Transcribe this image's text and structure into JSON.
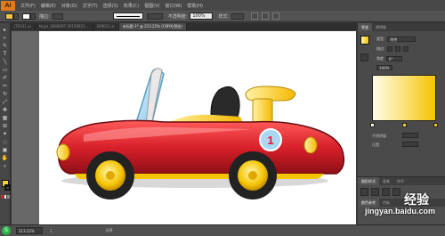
{
  "app": {
    "logo": "Ai"
  },
  "menubar": {
    "items": [
      "文件(F)",
      "编辑(E)",
      "对象(O)",
      "文字(T)",
      "选择(S)",
      "效果(C)",
      "视图(V)",
      "窗口(W)",
      "帮助(H)"
    ]
  },
  "controlbar": {
    "stroke_label": "描边:",
    "stroke_weight": "",
    "opacity_label": "不透明度:",
    "opacity_value": "100%",
    "style_label": "样式:"
  },
  "doctabs": [
    {
      "label": "JT0131.ai",
      "active": false
    },
    {
      "label": "hkjpz_2666007 20150821...",
      "active": false
    },
    {
      "label": "269011.ai",
      "active": false
    },
    {
      "label": "未标题-1* @ 213.22% (CMYK/预览)",
      "active": true
    }
  ],
  "toolbox": {
    "tools": [
      "▸",
      "▹",
      "✎",
      "T",
      "╲",
      "▭",
      "✐",
      "✂",
      "↻",
      "⤢",
      "✤",
      "▦",
      "⊞",
      "✦",
      "◌",
      "▣",
      "✋",
      "⌕"
    ]
  },
  "panels": {
    "top_tabs": [
      "渐变",
      "透明度"
    ],
    "type_label": "类型:",
    "type_value": "线性",
    "stroke_label": "描边:",
    "angle_label": "角度",
    "angle_value": "0°",
    "aspect_value": "100%",
    "opacity_label": "不透明度:",
    "location_label": "位置:",
    "lower_tabs": [
      "图形样式",
      "画笔",
      "符号"
    ],
    "lower_tabs2": [
      "颜色参考",
      "色板"
    ]
  },
  "car": {
    "body_color": "#d9212a",
    "trim_color": "#f5c400",
    "wheel_color": "#222222",
    "windshield_color": "#a9d8f0",
    "number": "1"
  },
  "statusbar": {
    "zoom": "213.22%",
    "page": "1",
    "tool_text": "选择"
  },
  "watermark": {
    "text": "jingyan.baidu.com",
    "cn": "经验"
  }
}
